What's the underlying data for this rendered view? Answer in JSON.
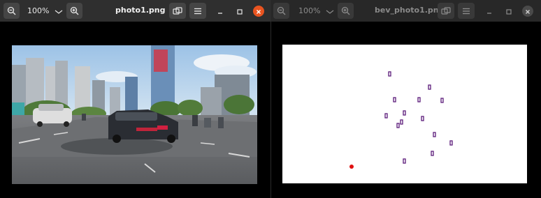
{
  "left_window": {
    "title": "photo1.png",
    "zoom": "100%",
    "active": true,
    "icons": [
      "zoom-out-icon",
      "chevron-down-icon",
      "zoom-in-icon",
      "rotate-icon",
      "hamburger-menu-icon",
      "minimize-icon",
      "maximize-icon",
      "close-icon"
    ],
    "close_color": "#e95420"
  },
  "right_window": {
    "title": "bev_photo1.png",
    "zoom": "100%",
    "active": false,
    "icons": [
      "zoom-out-icon",
      "chevron-down-icon",
      "zoom-in-icon",
      "rotate-icon",
      "hamburger-menu-icon",
      "minimize-icon",
      "maximize-icon",
      "close-icon"
    ],
    "bev": {
      "vehicle_color": "#5b1a7a",
      "ego_color": "#e01010",
      "vehicle_count": 16
    }
  }
}
